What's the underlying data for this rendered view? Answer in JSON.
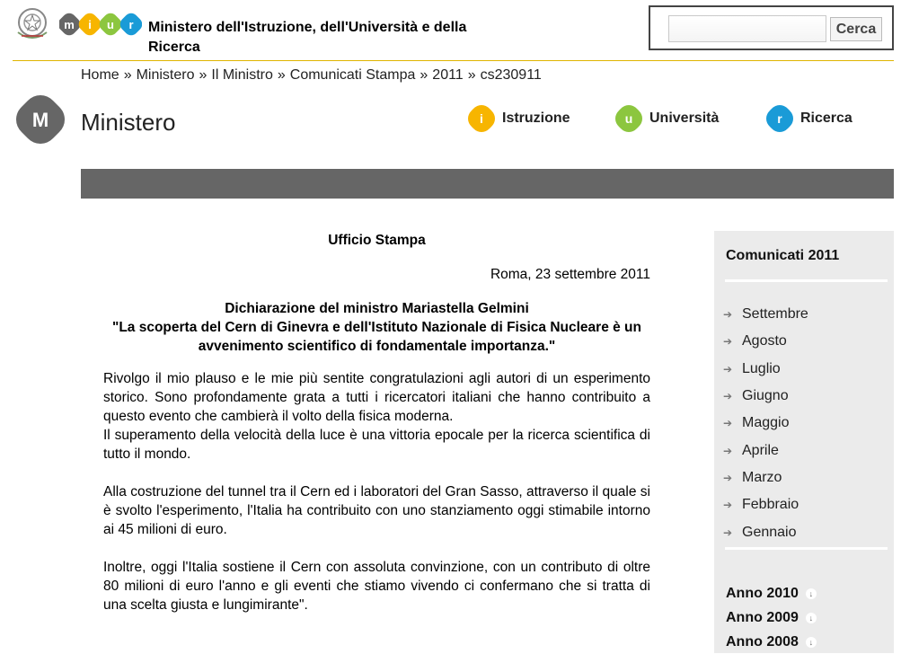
{
  "header": {
    "org_name": "Ministero dell'Istruzione, dell'Università e della Ricerca",
    "emblem_icon": "italian-republic-emblem-icon",
    "logo_icon": "miur-logo-icon",
    "logo_letters": [
      "m",
      "i",
      "u",
      "r"
    ],
    "logo_colors": [
      "#666666",
      "#f7b500",
      "#8cc63f",
      "#1a9bd7"
    ],
    "search": {
      "placeholder": "",
      "value": "",
      "button_label": "Cerca"
    }
  },
  "breadcrumb": {
    "items": [
      "Home",
      "Ministero",
      "Il Ministro",
      "Comunicati Stampa",
      "2011",
      "cs230911"
    ],
    "separator": "»"
  },
  "section": {
    "icon_letter": "M",
    "title": "Ministero",
    "portals": [
      {
        "letter": "i",
        "label": "Istruzione",
        "color": "#f7b500"
      },
      {
        "letter": "u",
        "label": "Università",
        "color": "#8cc63f"
      },
      {
        "letter": "r",
        "label": "Ricerca",
        "color": "#1a9bd7"
      }
    ],
    "band_color": "#666666"
  },
  "article": {
    "office": "Ufficio Stampa",
    "date": "Roma, 23 settembre 2011",
    "title_line1": "Dichiarazione del ministro Mariastella Gelmini",
    "title_line2": "\"La scoperta del Cern di Ginevra e dell'Istituto Nazionale di Fisica Nucleare è un avvenimento scientifico di fondamentale importanza.\"",
    "paragraphs": [
      "Rivolgo il mio plauso e le mie più sentite congratulazioni agli autori di un esperimento storico. Sono profondamente grata a tutti i ricercatori italiani che hanno contribuito a questo evento che cambierà il volto della fisica moderna.",
      "Il superamento della velocità della luce è una vittoria epocale per la ricerca scientifica di tutto il mondo.",
      "Alla costruzione del tunnel tra il Cern ed i laboratori del Gran Sasso, attraverso il quale si è svolto l'esperimento, l'Italia ha contribuito con uno stanziamento oggi stimabile intorno ai 45 milioni di euro.",
      "Inoltre, oggi l'Italia sostiene il Cern con assoluta convinzione, con un contributo di oltre 80 milioni di euro l'anno e gli eventi che stiamo vivendo ci confermano che si tratta di una scelta giusta e lungimirante\"."
    ]
  },
  "sidebar": {
    "title": "Comunicati 2011",
    "months": [
      "Settembre",
      "Agosto",
      "Luglio",
      "Giugno",
      "Maggio",
      "Aprile",
      "Marzo",
      "Febbraio",
      "Gennaio"
    ],
    "years": [
      "Anno 2010",
      "Anno 2009",
      "Anno 2008"
    ],
    "month_bullet_icon": "arrow-right-icon",
    "year_toggle_icon": "arrow-down-icon"
  }
}
